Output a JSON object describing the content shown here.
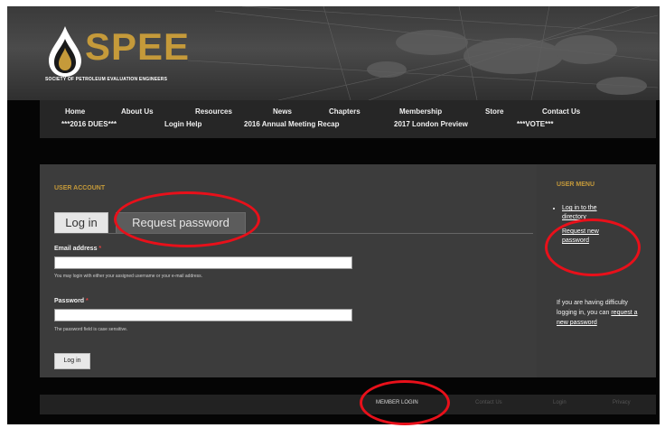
{
  "logo": {
    "text": "SPEE",
    "subtitle": "SOCIETY OF PETROLEUM EVALUATION ENGINEERS"
  },
  "nav": {
    "row1": [
      "Home",
      "About Us",
      "Resources",
      "News",
      "Chapters",
      "Membership",
      "Store",
      "Contact Us"
    ],
    "row2": [
      "***2016 DUES***",
      "Login Help",
      "2016 Annual Meeting Recap",
      "2017 London Preview",
      "***VOTE***"
    ]
  },
  "user_account": {
    "title": "USER ACCOUNT",
    "tabs": {
      "login": "Log in",
      "request": "Request password"
    },
    "email": {
      "label": "Email address",
      "required": "*",
      "help": "You may login with either your assigned username or your e-mail address."
    },
    "password": {
      "label": "Password",
      "required": "*",
      "help": "The password field is case sensitive."
    },
    "submit": "Log in"
  },
  "user_menu": {
    "title": "USER MENU",
    "links": [
      "Log in to the directory",
      "Request new password"
    ],
    "note_text": "If you are having difficulty logging in, you can",
    "note_link": "request a new password"
  },
  "footer": {
    "items": [
      "MEMBER LOGIN",
      "Contact Us",
      "Login",
      "Privacy"
    ]
  },
  "colors": {
    "accent": "#c59a3a",
    "annotation": "#e8101a",
    "panel": "#3c3c3c"
  }
}
